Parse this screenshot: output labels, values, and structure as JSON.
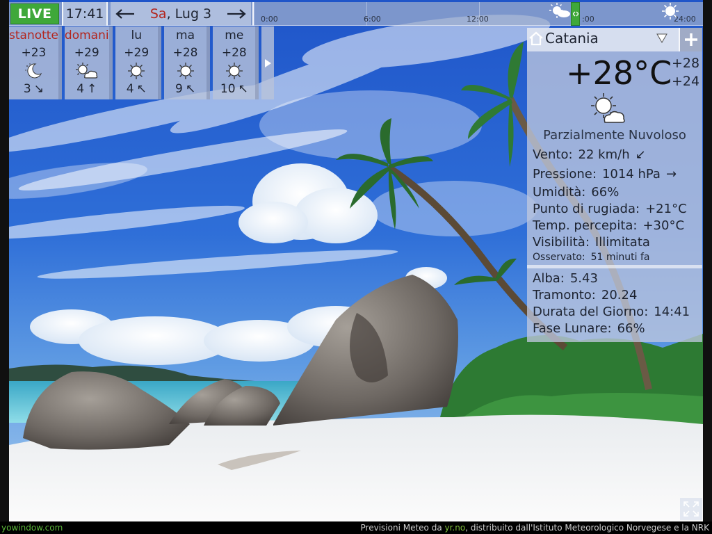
{
  "topbar": {
    "live_label": "LIVE",
    "time": "17:41",
    "date_weekday": "Sa",
    "date_rest": ", Lug 3",
    "timeline_labels": [
      "0:00",
      "6:00",
      "12:00",
      "",
      "24:00"
    ],
    "timeline_hidden_label": "18:00"
  },
  "forecast": {
    "days": [
      {
        "name": "stanotte",
        "highlight": true,
        "temp": "+23",
        "icon": "moon-icon",
        "wind_speed": "3",
        "wind_arrow": "↘"
      },
      {
        "name": "domani",
        "highlight": true,
        "temp": "+29",
        "icon": "sun-cloud-icon",
        "wind_speed": "4",
        "wind_arrow": "↑"
      },
      {
        "name": "lu",
        "highlight": false,
        "temp": "+29",
        "icon": "sun-icon",
        "wind_speed": "4",
        "wind_arrow": "↖"
      },
      {
        "name": "ma",
        "highlight": false,
        "temp": "+28",
        "icon": "sun-icon",
        "wind_speed": "9",
        "wind_arrow": "↖"
      },
      {
        "name": "me",
        "highlight": false,
        "temp": "+28",
        "icon": "sun-icon",
        "wind_speed": "10",
        "wind_arrow": "↖"
      }
    ]
  },
  "current": {
    "location": "Catania",
    "temperature": "+28°C",
    "high": "+28",
    "low": "+24",
    "condition": "Parzialmente Nuvoloso",
    "wind_label": "Vento:",
    "wind_value": "22 km/h",
    "wind_arrow": "↙",
    "pressure_label": "Pressione:",
    "pressure_value": "1014 hPa",
    "pressure_arrow": "→",
    "humidity_label": "Umidità:",
    "humidity_value": "66%",
    "dewpoint_label": "Punto di rugiada:",
    "dewpoint_value": "+21°C",
    "feels_label": "Temp. percepita:",
    "feels_value": "+30°C",
    "visibility_label": "Visibilità:",
    "visibility_value": "Illimitata",
    "observed_label": "Osservato:",
    "observed_value": "51 minuti fa",
    "sunrise_label": "Alba:",
    "sunrise_value": "5.43",
    "sunset_label": "Tramonto:",
    "sunset_value": "20.24",
    "daylength_label": "Durata del Giorno:",
    "daylength_value": "14:41",
    "moon_label": "Fase Lunare:",
    "moon_value": "66%"
  },
  "footer": {
    "site": "yowindow.com",
    "credit_prefix": "Previsioni Meteo da ",
    "credit_link": "yr.no",
    "credit_suffix": ", distribuito dall'Istituto Meteorologico Norvegese e la NRK"
  },
  "colors": {
    "live_green": "#3fa83a",
    "highlight_red": "#b3261e",
    "panel_bg": "#bec6de"
  }
}
